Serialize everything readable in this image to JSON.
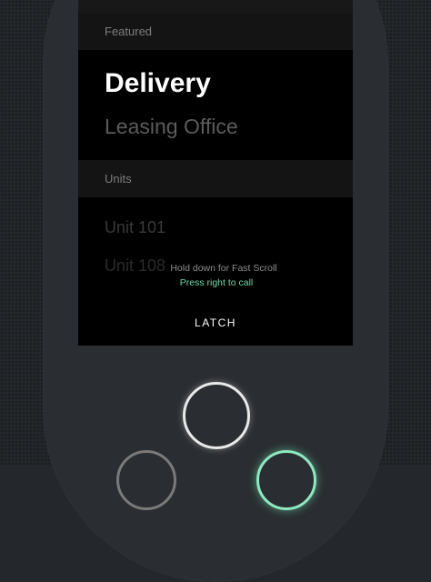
{
  "directory": {
    "sections": [
      {
        "header": "Featured"
      },
      {
        "header": "Units"
      }
    ],
    "items": [
      {
        "label": "Delivery"
      },
      {
        "label": "Leasing Office"
      },
      {
        "label": "Unit 101"
      },
      {
        "label": "Unit 108"
      }
    ]
  },
  "hints": {
    "fast_scroll": "Hold down for Fast Scroll",
    "call": "Press right to call"
  },
  "brand": {
    "logo_text": "LATCH"
  },
  "colors": {
    "accent_green": "#6fd6a8",
    "screen_bg": "#000000",
    "device_bg": "#2a2d31"
  }
}
